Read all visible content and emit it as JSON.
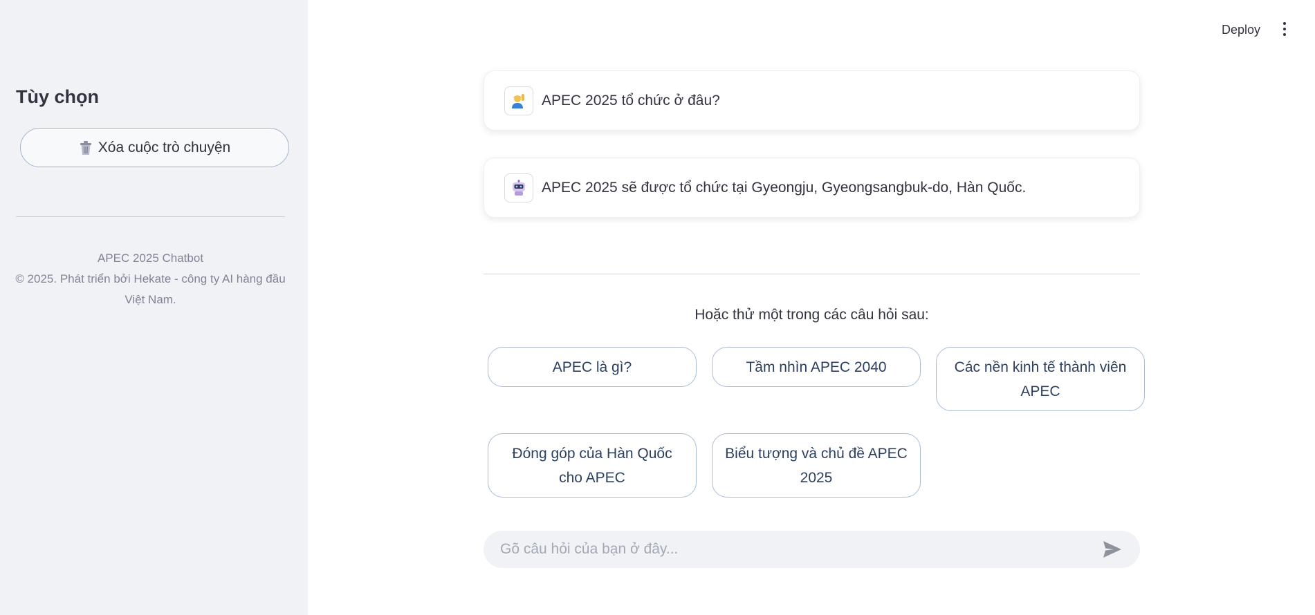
{
  "sidebar": {
    "title": "Tùy chọn",
    "clear_button": "Xóa cuộc trò chuyện",
    "footer_line1": "APEC 2025 Chatbot",
    "footer_line2": "© 2025. Phát triển bởi Hekate - công ty AI hàng đầu Việt Nam."
  },
  "header": {
    "deploy": "Deploy",
    "menu_icon": "kebab-menu-icon"
  },
  "messages": [
    {
      "role": "user",
      "avatar_icon": "person-raising-hand-icon",
      "text": "APEC 2025 tổ chức ở đâu?"
    },
    {
      "role": "assistant",
      "avatar_icon": "robot-icon",
      "text": "APEC 2025 sẽ được tổ chức tại Gyeongju, Gyeongsangbuk-do, Hàn Quốc."
    }
  ],
  "suggestions": {
    "title": "Hoặc thử một trong các câu hỏi sau:",
    "items": [
      "APEC là gì?",
      "Tầm nhìn APEC 2040",
      "Các nền kinh tế thành viên APEC",
      "Đóng góp của Hàn Quốc cho APEC",
      "Biểu tượng và chủ đề APEC 2025"
    ]
  },
  "chat_input": {
    "placeholder": "Gõ câu hỏi của bạn ở đây...",
    "value": ""
  },
  "colors": {
    "sidebar_bg": "#f0f2f6",
    "text": "#31333f",
    "button_border": "#a9bdd8",
    "muted": "#808495"
  }
}
